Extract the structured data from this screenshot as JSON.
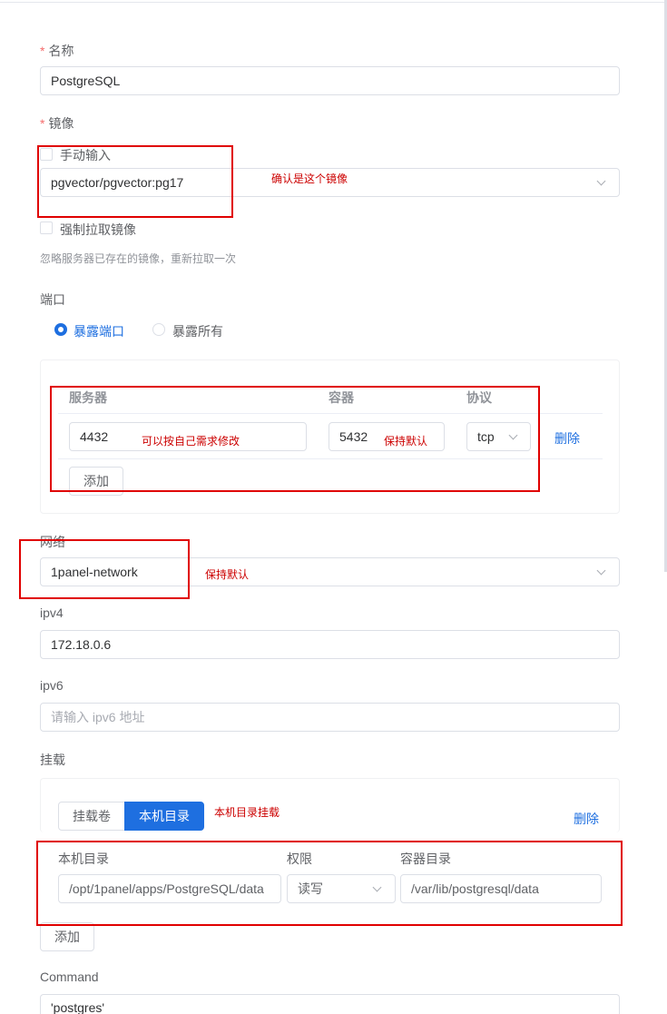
{
  "form": {
    "name": {
      "label": "名称",
      "value": "PostgreSQL"
    },
    "image": {
      "label": "镜像",
      "manual_input_label": "手动输入",
      "value": "pgvector/pgvector:pg17",
      "force_pull_label": "强制拉取镜像",
      "force_pull_hint": "忽略服务器已存在的镜像，重新拉取一次"
    },
    "port": {
      "label": "端口",
      "radio_expose": "暴露端口",
      "radio_expose_all": "暴露所有",
      "headers": {
        "server": "服务器",
        "container": "容器",
        "protocol": "协议"
      },
      "rows": [
        {
          "server": "4432",
          "container": "5432",
          "protocol": "tcp",
          "delete": "删除"
        }
      ],
      "add_label": "添加"
    },
    "network": {
      "label": "网络",
      "value": "1panel-network"
    },
    "ipv4": {
      "label": "ipv4",
      "value": "172.18.0.6"
    },
    "ipv6": {
      "label": "ipv6",
      "placeholder": "请输入 ipv6 地址"
    },
    "mount": {
      "label": "挂载",
      "tab_volume": "挂载卷",
      "tab_host_dir": "本机目录",
      "delete": "删除",
      "headers": {
        "host_dir": "本机目录",
        "permission": "权限",
        "container_dir": "容器目录"
      },
      "rows": [
        {
          "host_dir": "/opt/1panel/apps/PostgreSQL/data",
          "permission": "读写",
          "container_dir": "/var/lib/postgresql/data"
        }
      ],
      "add_label": "添加"
    },
    "command": {
      "label": "Command",
      "value": "'postgres'"
    }
  },
  "annotations": {
    "image_note": "确认是这个镜像",
    "port_note": "可以按自己需求修改",
    "container_note": "保持默认",
    "network_note": "保持默认",
    "mount_note": "本机目录挂载"
  },
  "colors": {
    "accent": "#1e6fe0",
    "annotation": "#e00000",
    "required": "#f56c6c"
  }
}
